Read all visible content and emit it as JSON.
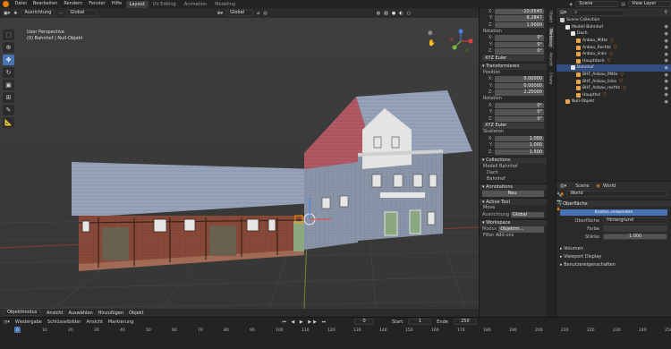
{
  "menu": [
    "Datei",
    "Bearbeiten",
    "Rendern",
    "Fenster",
    "Hilfe"
  ],
  "workspaces": [
    "Layout",
    "UV Editing",
    "Animation",
    "Modeling"
  ],
  "scene": {
    "label": "Scene",
    "view_layer": "View Layer"
  },
  "viewport": {
    "mode": "Ausrichtung",
    "orientation": "Global",
    "transform": "Global",
    "info_line1": "User Perspective",
    "info_line2": "(0) Bahnhof | Null-Objekt",
    "footer": [
      "Objektmodus",
      "Ansicht",
      "Auswählen",
      "Hinzufügen",
      "Objekt"
    ]
  },
  "tools": [
    "cursor-select",
    "cursor",
    "move",
    "rotate",
    "scale",
    "transform",
    "annotate",
    "measure"
  ],
  "sidebar": {
    "top_values": [
      {
        "axis": "X:",
        "value": "-10.0545"
      },
      {
        "axis": "Y:",
        "value": "8.2847"
      },
      {
        "axis": "Z:",
        "value": "1.0000"
      }
    ],
    "rotation_label": "Rotation",
    "rot_values": [
      {
        "axis": "X:",
        "value": "0°"
      },
      {
        "axis": "Y:",
        "value": "0°"
      },
      {
        "axis": "Z:",
        "value": "0°"
      }
    ],
    "euler": "XYZ Euler",
    "transform_panel": "Transformieren",
    "position_label": "Position",
    "pos_values": [
      {
        "axis": "X:",
        "value": "0.00000"
      },
      {
        "axis": "Y:",
        "value": "0.00000"
      },
      {
        "axis": "Z:",
        "value": "2.25000"
      }
    ],
    "rotation2_label": "Rotation",
    "rot2_values": [
      {
        "axis": "X:",
        "value": "0°"
      },
      {
        "axis": "Y:",
        "value": "0°"
      },
      {
        "axis": "Z:",
        "value": "0°"
      }
    ],
    "euler2": "XYZ Euler",
    "scale_label": "Skalieren",
    "scale_values": [
      {
        "axis": "X:",
        "value": "1.000"
      },
      {
        "axis": "Y:",
        "value": "1.000"
      },
      {
        "axis": "Z:",
        "value": "1.500"
      }
    ],
    "collections_panel": "Collections",
    "collections": [
      "Modell Bahnhof",
      "Dach",
      "Bahnhof"
    ],
    "annotations_panel": "Annotations",
    "annotations_new": "Neu",
    "active_tool_panel": "Active Tool",
    "active_tool": "Move",
    "orientation_label": "Ausrichtung",
    "orientation_value": "Global",
    "workspace_panel": "Workspace",
    "modus_label": "Modus",
    "modus_value": "Objektm...",
    "filter_add_ons": "Filter Add-ons"
  },
  "sidebar_tabs": [
    "Objekt",
    "Werkzeug",
    "Ansicht",
    "Create"
  ],
  "outliner": {
    "root": "Scene Collection",
    "rows": [
      {
        "label": "Modell Bahnhof",
        "indent": 1,
        "color": "#e6e6e6"
      },
      {
        "label": "Dach",
        "indent": 2,
        "color": "#e6e6e6"
      },
      {
        "label": "Anbau_Mitte",
        "indent": 3,
        "color": "#e8a54b"
      },
      {
        "label": "Anbau_Rechts",
        "indent": 3,
        "color": "#e8a54b"
      },
      {
        "label": "Anbau_links",
        "indent": 3,
        "color": "#e8a54b"
      },
      {
        "label": "Hauptdach",
        "indent": 3,
        "color": "#e8a54b"
      },
      {
        "label": "Bahnhof",
        "indent": 2,
        "color": "#e6e6e6",
        "selected": true
      },
      {
        "label": "BHF_Anbau_Mitte",
        "indent": 3,
        "color": "#e8a54b"
      },
      {
        "label": "BHF_Anbau_links",
        "indent": 3,
        "color": "#e8a54b"
      },
      {
        "label": "BHF_Anbau_rechts",
        "indent": 3,
        "color": "#e8a54b"
      },
      {
        "label": "Haupthsl",
        "indent": 3,
        "color": "#e8a54b"
      },
      {
        "label": "Null-Objekt",
        "indent": 1,
        "color": "#e8a54b"
      }
    ]
  },
  "world_props": {
    "scene_tab": "Scene",
    "world_tab": "World",
    "world_name": "World",
    "surface_panel": "Oberfläche",
    "use_nodes": "Knoten verwenden",
    "surface_label": "Oberfläche",
    "surface_value": "Hintergrund",
    "color_label": "Farbe",
    "strength_label": "Stärke",
    "strength_value": "1.000",
    "volume_panel": "Volumen",
    "viewport_panel": "Viewport Display",
    "custom_panel": "Benutzereigenschaften"
  },
  "timeline": {
    "menus": [
      "Wiedergabe",
      "Schlüsselbilder",
      "Ansicht",
      "Markierung"
    ],
    "current_frame": "0",
    "start_label": "Start",
    "start_value": "1",
    "end_label": "Ende",
    "end_value": "250",
    "ticks": [
      "0",
      "10",
      "20",
      "30",
      "40",
      "50",
      "60",
      "70",
      "80",
      "90",
      "100",
      "110",
      "120",
      "130",
      "140",
      "150",
      "160",
      "170",
      "180",
      "190",
      "200",
      "210",
      "220",
      "230",
      "240",
      "250"
    ]
  }
}
